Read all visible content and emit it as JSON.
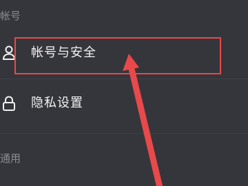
{
  "sections": {
    "account_header": "帐号",
    "general_header": "通用"
  },
  "items": {
    "account_security": {
      "label": "帐号与安全",
      "icon": "person-icon"
    },
    "privacy": {
      "label": "隐私设置",
      "icon": "lock-icon"
    }
  },
  "annotation": {
    "color": "#e8494a",
    "highlight": "item-account-security",
    "arrow": "pointing-up-left"
  },
  "colors": {
    "background": "#35363b",
    "text_primary": "#f2f2f4",
    "text_secondary": "#8c8c91"
  }
}
